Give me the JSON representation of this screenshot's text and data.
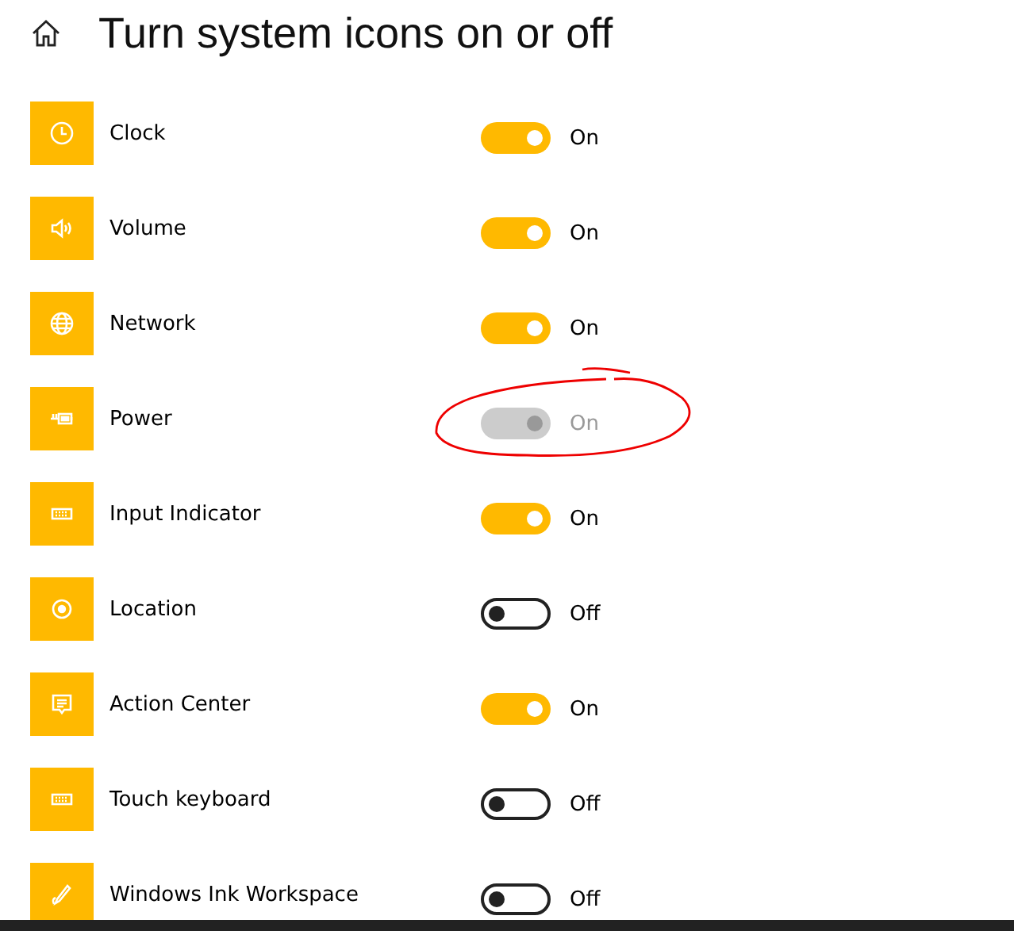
{
  "header": {
    "title": "Turn system icons on or off"
  },
  "items": [
    {
      "name": "Clock",
      "on": true,
      "disabled": false,
      "status": "On"
    },
    {
      "name": "Volume",
      "on": true,
      "disabled": false,
      "status": "On"
    },
    {
      "name": "Network",
      "on": true,
      "disabled": false,
      "status": "On"
    },
    {
      "name": "Power",
      "on": true,
      "disabled": true,
      "status": "On"
    },
    {
      "name": "Input Indicator",
      "on": true,
      "disabled": false,
      "status": "On"
    },
    {
      "name": "Location",
      "on": false,
      "disabled": false,
      "status": "Off"
    },
    {
      "name": "Action Center",
      "on": true,
      "disabled": false,
      "status": "On"
    },
    {
      "name": "Touch keyboard",
      "on": false,
      "disabled": false,
      "status": "Off"
    },
    {
      "name": "Windows Ink Workspace",
      "on": false,
      "disabled": false,
      "status": "Off"
    }
  ]
}
